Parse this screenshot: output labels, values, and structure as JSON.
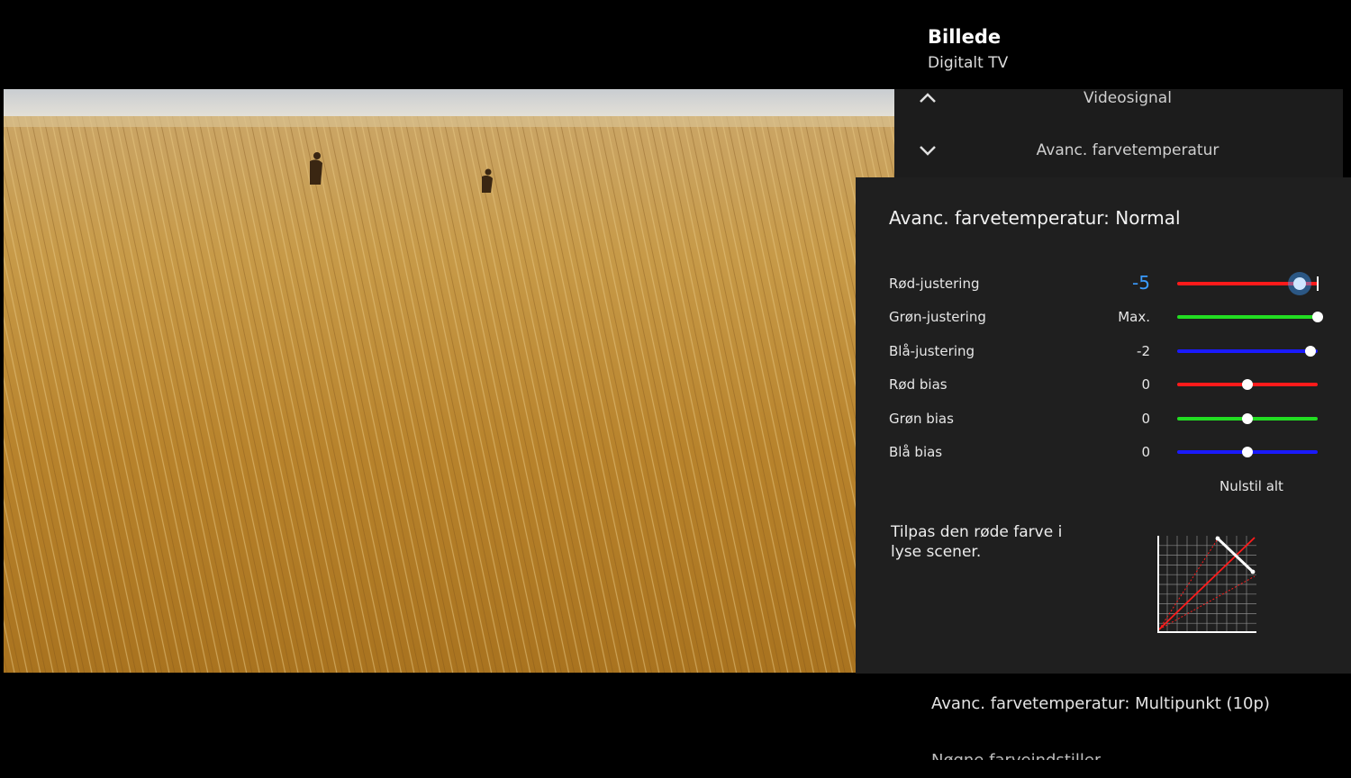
{
  "header": {
    "title": "Billede",
    "subtitle": "Digitalt TV"
  },
  "menu": [
    {
      "label": "Videosignal",
      "icon": "chevron-up-icon"
    },
    {
      "label": "Avanc. farvetemperatur",
      "icon": "chevron-down-icon"
    }
  ],
  "panel": {
    "title": "Avanc. farvetemperatur: Normal",
    "rows": [
      {
        "name": "Rød-justering",
        "value": "-5",
        "level": 0.87,
        "color": "#ff1a1a"
      },
      {
        "name": "Grøn-justering",
        "value": "Max.",
        "level": 1.0,
        "color": "#22dd22"
      },
      {
        "name": "Blå-justering",
        "value": "-2",
        "level": 0.95,
        "color": "#1a1aff"
      },
      {
        "name": "Rød bias",
        "value": "0",
        "level": 0.5,
        "color": "#ff1a1a"
      },
      {
        "name": "Grøn bias",
        "value": "0",
        "level": 0.5,
        "color": "#22dd22"
      },
      {
        "name": "Blå bias",
        "value": "0",
        "level": 0.5,
        "color": "#1a1aff"
      }
    ],
    "reset_label": "Nulstil alt",
    "help_text": "Tilpas den røde farve i lyse scener."
  },
  "bottom": {
    "item": "Avanc. farvetemperatur: Multipunkt (10p)",
    "cut_item": "Nøgne farveindstiller"
  }
}
